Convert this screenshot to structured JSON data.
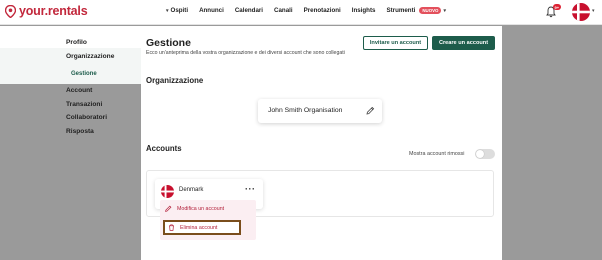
{
  "app": {
    "logo_text": "your.rentals",
    "brand_color": "#c2283c",
    "accent_color": "#1d5c4b"
  },
  "nav": {
    "items": [
      {
        "label": "Ospiti",
        "has_caret": true
      },
      {
        "label": "Annunci"
      },
      {
        "label": "Calendari"
      },
      {
        "label": "Canali"
      },
      {
        "label": "Prenotazioni"
      },
      {
        "label": "Insights"
      },
      {
        "label": "Strumenti",
        "badge": "NUOVO",
        "has_caret": true
      }
    ],
    "notification_count": "9+",
    "avatar_icon": "denmark-flag-icon"
  },
  "sidebar": {
    "items": [
      {
        "label": "Profilo"
      },
      {
        "label": "Organizzazione"
      },
      {
        "label": "Gestione"
      },
      {
        "label": "Account"
      },
      {
        "label": "Transazioni"
      },
      {
        "label": "Collaboratori"
      },
      {
        "label": "Risposta"
      }
    ]
  },
  "main": {
    "title": "Gestione",
    "description": "Ecco un'anteprima della vostra organizzazione e dei diversi account che sono collegati",
    "invite_button": "Invitare un account",
    "create_button": "Creare un account",
    "org_section_title": "Organizzazione",
    "org_name": "John Smith Organisation",
    "accounts_section_title": "Accounts",
    "show_removed_label": "Mostra account rimossi",
    "show_removed_on": false,
    "account": {
      "name": "Denmark",
      "flag_icon": "denmark-flag-icon",
      "more_icon": "more-dots-icon"
    },
    "menu": {
      "edit_label": "Modifica un account",
      "delete_label": "Elimina account"
    }
  }
}
